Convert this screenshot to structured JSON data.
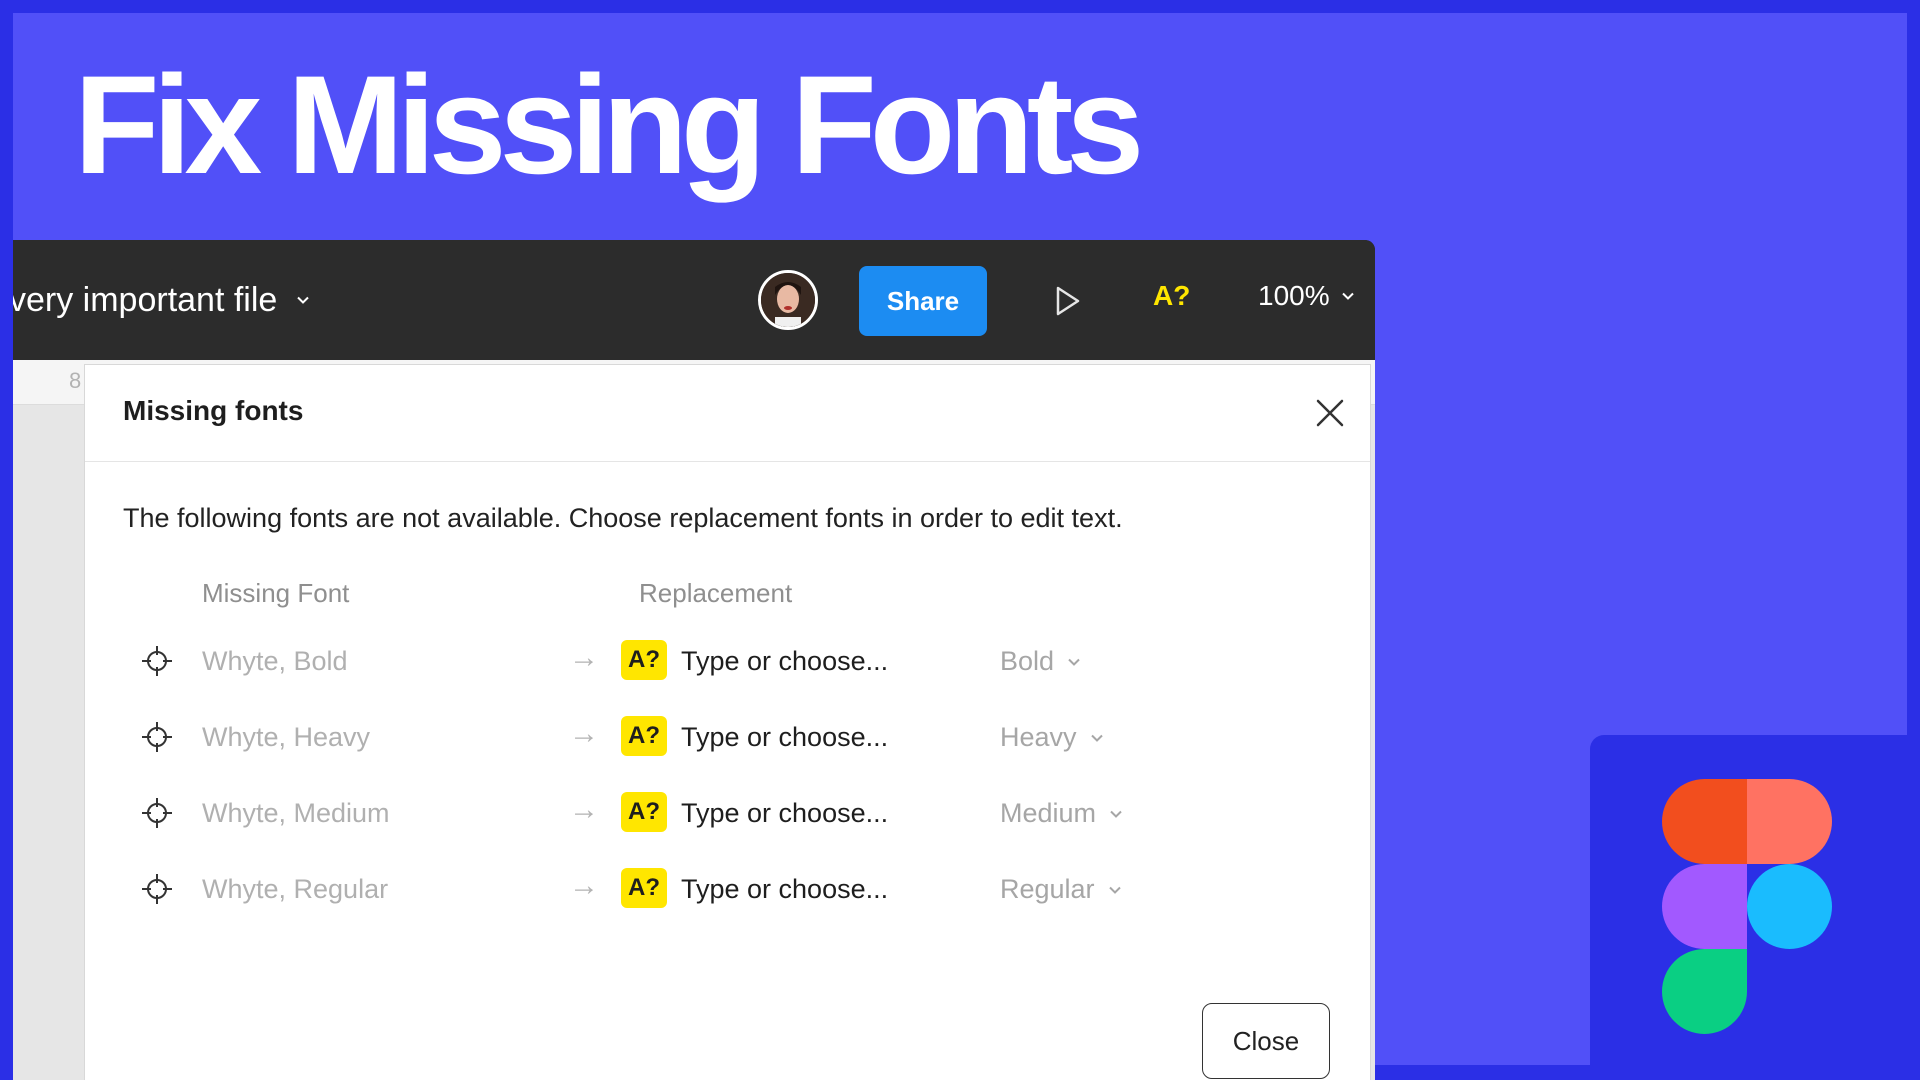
{
  "title": "Fix Missing Fonts",
  "colors": {
    "background": "#5150f8",
    "frame": "#2b2fe6",
    "share_button": "#1c8cf2",
    "warning": "#ffe600",
    "figma_red": "#f24e1e",
    "figma_salmon": "#ff7262",
    "figma_purple": "#a259ff",
    "figma_blue": "#1abcfe",
    "figma_green": "#0acf83"
  },
  "toolbar": {
    "file_name": "very important file",
    "share_label": "Share",
    "missing_fonts_indicator": "A?",
    "zoom": "100%"
  },
  "canvas": {
    "ruler_number": "8"
  },
  "modal": {
    "title": "Missing fonts",
    "description": "The following fonts are not available. Choose replacement fonts in order to edit text.",
    "columns": {
      "missing_font": "Missing Font",
      "replacement": "Replacement"
    },
    "rows": [
      {
        "font": "Whyte, Bold",
        "badge": "A?",
        "placeholder": "Type or choose...",
        "style": "Bold"
      },
      {
        "font": "Whyte, Heavy",
        "badge": "A?",
        "placeholder": "Type or choose...",
        "style": "Heavy"
      },
      {
        "font": "Whyte, Medium",
        "badge": "A?",
        "placeholder": "Type or choose...",
        "style": "Medium"
      },
      {
        "font": "Whyte, Regular",
        "badge": "A?",
        "placeholder": "Type or choose...",
        "style": "Regular"
      }
    ],
    "close_label": "Close"
  },
  "icons": {
    "file_menu": "chevron-down-icon",
    "play": "play-icon",
    "close": "close-icon",
    "locate": "crosshair-icon",
    "arrow": "arrow-right-icon",
    "logo": "figma-logo"
  }
}
